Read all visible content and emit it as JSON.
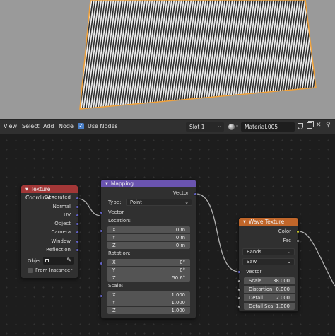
{
  "header": {
    "menu": [
      "View",
      "Select",
      "Add",
      "Node"
    ],
    "use_nodes_label": "Use Nodes",
    "use_nodes_checked": true,
    "slot": "Slot 1",
    "material_name": "Material.005"
  },
  "nodes": {
    "texture_coordinate": {
      "title": "Texture Coordinate",
      "outputs": [
        "Generated",
        "Normal",
        "UV",
        "Object",
        "Camera",
        "Window",
        "Reflection"
      ],
      "object_label": "Objec",
      "from_instancer_label": "From Instancer",
      "header_color": "#a33737"
    },
    "mapping": {
      "title": "Mapping",
      "output": "Vector",
      "type_label": "Type:",
      "type_value": "Point",
      "input_vector": "Vector",
      "location_label": "Location:",
      "location": [
        {
          "axis": "X",
          "value": "0 m"
        },
        {
          "axis": "Y",
          "value": "0 m"
        },
        {
          "axis": "Z",
          "value": "0 m"
        }
      ],
      "rotation_label": "Rotation:",
      "rotation": [
        {
          "axis": "X",
          "value": "0°"
        },
        {
          "axis": "Y",
          "value": "0°"
        },
        {
          "axis": "Z",
          "value": "50.6°"
        }
      ],
      "scale_label": "Scale:",
      "scale": [
        {
          "axis": "X",
          "value": "1.000"
        },
        {
          "axis": "Y",
          "value": "1.000"
        },
        {
          "axis": "Z",
          "value": "1.000"
        }
      ],
      "header_color": "#6a54b0"
    },
    "wave_texture": {
      "title": "Wave Texture",
      "outputs": [
        "Color",
        "Fac"
      ],
      "wave_type": "Bands",
      "profile": "Saw",
      "input_vector": "Vector",
      "inputs": [
        {
          "label": "Scale",
          "value": "38.000"
        },
        {
          "label": "Distortion",
          "value": "0.000"
        },
        {
          "label": "Detail",
          "value": "2.000"
        },
        {
          "label": "Detail Scal",
          "value": "1.000"
        }
      ],
      "header_color": "#c0662a"
    }
  },
  "colors": {
    "vector_socket": "#6363c7",
    "color_socket": "#c7c729",
    "float_socket": "#a1a1a1",
    "selection_outline": "#f0a13a"
  }
}
